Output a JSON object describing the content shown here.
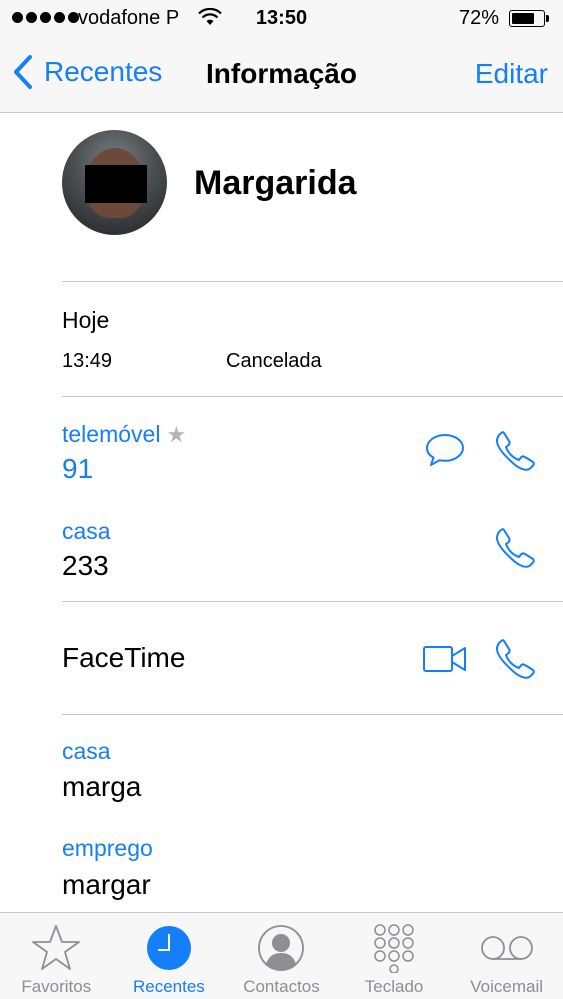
{
  "status": {
    "carrier": "vodafone P",
    "time": "13:50",
    "battery": "72%"
  },
  "nav": {
    "back_label": "Recentes",
    "title": "Informação",
    "edit_label": "Editar"
  },
  "contact": {
    "name": "Margarida"
  },
  "call_log": {
    "day": "Hoje",
    "time": "13:49",
    "status": "Cancelada"
  },
  "phones": [
    {
      "label": "telemóvel",
      "value": "91",
      "favorite": true
    },
    {
      "label": "casa",
      "value": "233"
    }
  ],
  "facetime": {
    "label": "FaceTime"
  },
  "emails": [
    {
      "label": "casa",
      "value": "marga"
    },
    {
      "label": "emprego",
      "value": "margar"
    }
  ],
  "tabbar": {
    "items": [
      {
        "label": "Favoritos",
        "icon": "star-icon"
      },
      {
        "label": "Recentes",
        "icon": "clock-icon",
        "active": true
      },
      {
        "label": "Contactos",
        "icon": "contact-icon"
      },
      {
        "label": "Teclado",
        "icon": "keypad-icon"
      },
      {
        "label": "Voicemail",
        "icon": "voicemail-icon"
      }
    ]
  },
  "colors": {
    "accent": "#147efb",
    "inactive": "#8e8e93",
    "separator": "#c8c7cc"
  }
}
